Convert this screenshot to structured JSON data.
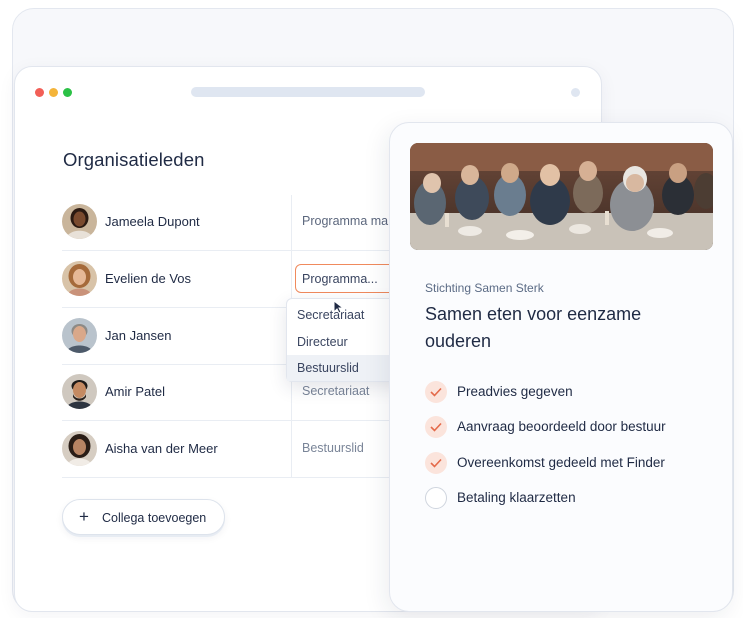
{
  "members_panel": {
    "title": "Organisatieleden",
    "members": [
      {
        "name": "Jameela Dupont",
        "role": "Programma ma"
      },
      {
        "name": "Evelien de Vos",
        "role": "Programma..."
      },
      {
        "name": "Jan Jansen",
        "role": ""
      },
      {
        "name": "Amir Patel",
        "role": "Secretariaat"
      },
      {
        "name": "Aisha van der Meer",
        "role": "Bestuurslid"
      }
    ],
    "role_dropdown": {
      "options": [
        "Secretariaat",
        "Directeur",
        "Bestuurslid"
      ],
      "hovered": "Bestuurslid"
    },
    "add_button": {
      "label": "Collega toevoegen",
      "icon": "plus-icon"
    }
  },
  "project_card": {
    "organization": "Stichting Samen Sterk",
    "title": "Samen eten voor eenzame ouderen",
    "steps": [
      {
        "label": "Preadvies gegeven",
        "done": true
      },
      {
        "label": "Aanvraag beoordeeld door bestuur",
        "done": true
      },
      {
        "label": "Overeenkomst gedeeld met Finder",
        "done": true
      },
      {
        "label": "Betaling klaarzetten",
        "done": false
      }
    ]
  },
  "colors": {
    "accent": "#f08a5d",
    "check_bg": "#fbe4dc",
    "text": "#1f2a44"
  }
}
